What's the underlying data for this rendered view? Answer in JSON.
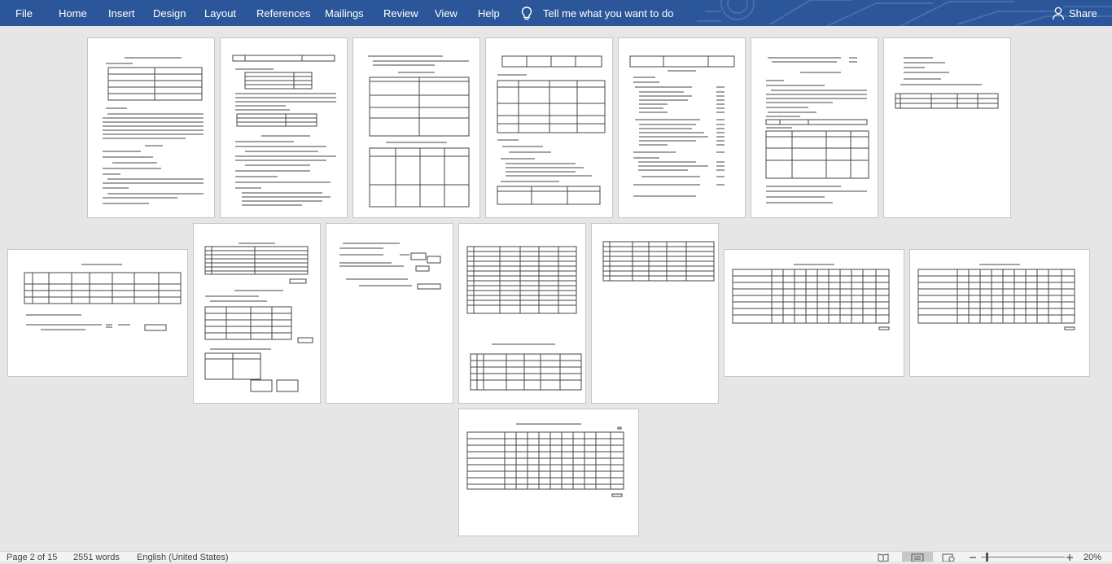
{
  "ribbon": {
    "tabs": [
      {
        "label": "File"
      },
      {
        "label": "Home"
      },
      {
        "label": "Insert"
      },
      {
        "label": "Design"
      },
      {
        "label": "Layout"
      },
      {
        "label": "References"
      },
      {
        "label": "Mailings"
      },
      {
        "label": "Review"
      },
      {
        "label": "View"
      },
      {
        "label": "Help"
      }
    ],
    "tell_me": "Tell me what you want to do",
    "share": "Share",
    "accent": "#2b579a"
  },
  "icons": {
    "tell_me": "lightbulb-icon",
    "share": "person-icon",
    "read_mode": "book-icon",
    "print_layout": "page-icon",
    "web_layout": "web-icon",
    "zoom_out": "minus-icon",
    "zoom_in": "plus-icon"
  },
  "status": {
    "page": "Page 2 of 15",
    "words": "2551 words",
    "language": "English (United States)",
    "zoom": "20%",
    "zoom_level_fraction": 0.2
  }
}
